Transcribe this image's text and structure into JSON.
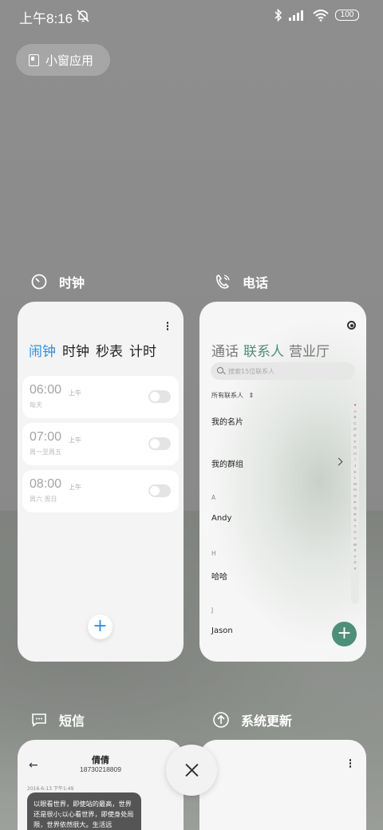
{
  "status_bar": {
    "time": "上午8:16",
    "battery": "100"
  },
  "small_window_button": {
    "label": "小窗应用"
  },
  "apps": {
    "clock": {
      "label": "时钟",
      "tabs": [
        "闹钟",
        "时钟",
        "秒表",
        "计时"
      ],
      "alarms": [
        {
          "time": "06:00",
          "ampm": "上午",
          "repeat": "每天"
        },
        {
          "time": "07:00",
          "ampm": "上午",
          "repeat": "周一至周五"
        },
        {
          "time": "08:00",
          "ampm": "上午",
          "repeat": "周六 周日"
        }
      ],
      "add_label": "+"
    },
    "phone": {
      "label": "电话",
      "tabs": [
        "通话",
        "联系人",
        "营业厅"
      ],
      "search_placeholder": "搜索15位联系人",
      "filter": "所有联系人",
      "my_card": "我的名片",
      "my_groups": "我的群组",
      "sections": [
        {
          "letter": "A",
          "name": "Andy"
        },
        {
          "letter": "H",
          "name": "哈哈"
        },
        {
          "letter": "J",
          "name": "Jason"
        }
      ],
      "alphabet": [
        "♥",
        "A",
        "B",
        "C",
        "D",
        "E",
        "F",
        "G",
        "H",
        "I",
        "J",
        "K",
        "L",
        "M",
        "N",
        "O",
        "P",
        "Q",
        "R",
        "S",
        "T",
        "U",
        "V",
        "W",
        "X",
        "Y",
        "Z",
        "#"
      ],
      "add_label": "+"
    },
    "sms": {
      "label": "短信",
      "contact_name": "倩倩",
      "contact_number": "18730218809",
      "date": "2016-6-13 下午1:49",
      "message": "以眼看世界，即使站的最高，世界还是很小;以心看世界，即使身处局限，世界依然很大。生活远"
    },
    "update": {
      "label": "系统更新"
    }
  },
  "close_all": {
    "icon": "close-icon"
  }
}
